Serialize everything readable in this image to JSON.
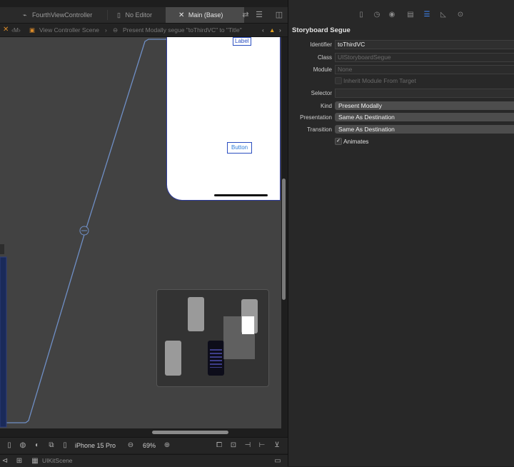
{
  "tabs": [
    {
      "label": "FourthViewController",
      "icon": "swift-icon"
    },
    {
      "label": "No Editor",
      "icon": "document-icon"
    },
    {
      "label": "Main (Base)",
      "icon": "storyboard-icon"
    }
  ],
  "jump_bar": {
    "items": [
      "M",
      "View Controller Scene",
      "Present Modally segue \"toThirdVC\" to \"Title\""
    ]
  },
  "canvas": {
    "phone_label": "Label",
    "phone_button": "Button"
  },
  "bottom_bar": {
    "device": "iPhone 15 Pro",
    "zoom": "69%"
  },
  "status_bar": {
    "scene": "UIKitScene"
  },
  "inspector": {
    "title": "Storyboard Segue",
    "identifier_label": "Identifier",
    "identifier_value": "toThirdVC",
    "class_label": "Class",
    "class_placeholder": "UIStoryboardSegue",
    "module_label": "Module",
    "module_placeholder": "None",
    "inherit_label": "Inherit Module From Target",
    "selector_label": "Selector",
    "selector_value": "",
    "kind_label": "Kind",
    "kind_value": "Present Modally",
    "presentation_label": "Presentation",
    "presentation_value": "Same As Destination",
    "transition_label": "Transition",
    "transition_value": "Same As Destination",
    "animates_label": "Animates",
    "animates_checked": true
  },
  "colors": {
    "accent": "#3e86f7",
    "canvas": "#424242",
    "segue_line": "#6f8fc6"
  }
}
